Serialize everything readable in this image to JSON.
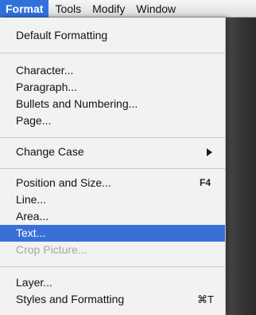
{
  "menubar": {
    "items": [
      "Format",
      "Tools",
      "Modify",
      "Window"
    ]
  },
  "menu": {
    "default_formatting": "Default Formatting",
    "character": "Character...",
    "paragraph": "Paragraph...",
    "bullets_numbering": "Bullets and Numbering...",
    "page": "Page...",
    "change_case": "Change Case",
    "position_size": "Position and Size...",
    "position_size_shortcut": "F4",
    "line": "Line...",
    "area": "Area...",
    "text": "Text...",
    "crop_picture": "Crop Picture...",
    "layer": "Layer...",
    "styles_formatting": "Styles and Formatting",
    "styles_formatting_shortcut": "⌘T"
  },
  "icons": {
    "submenu": "submenu-arrow-icon"
  },
  "colors": {
    "menubar_highlight": "#3171dc",
    "selected_item": "#3a6fd8",
    "disabled_text": "#a6a6a6"
  }
}
